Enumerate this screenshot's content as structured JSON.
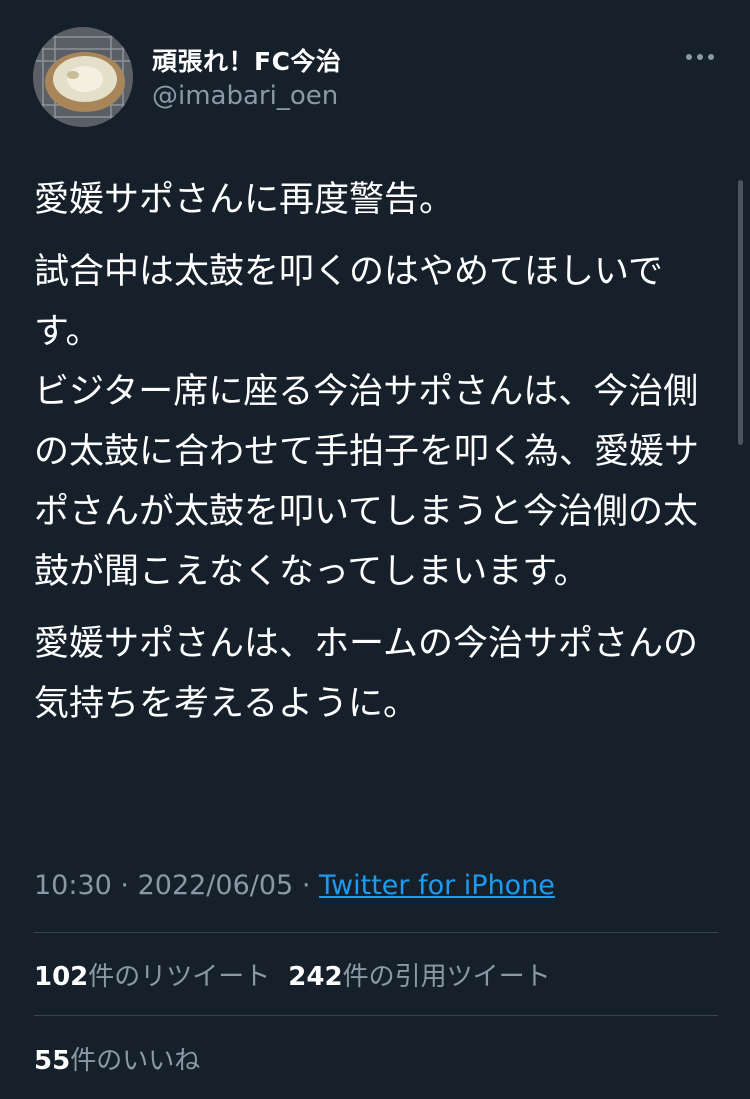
{
  "author": {
    "display_name": "頑張れ！FC今治",
    "handle": "@imabari_oen"
  },
  "tweet": {
    "paragraphs": [
      "愛媛サポさんに再度警告。",
      "試合中は太鼓を叩くのはやめてほしいです。\nビジター席に座る今治サポさんは、今治側の太鼓に合わせて手拍子を叩く為、愛媛サポさんが太鼓を叩いてしまうと今治側の太鼓が聞こえなくなってしまいます。",
      "愛媛サポさんは、ホームの今治サポさんの気持ちを考えるように。"
    ]
  },
  "meta": {
    "time": "10:30",
    "separator": "·",
    "date": "2022/06/05",
    "source": "Twitter for iPhone"
  },
  "stats": {
    "retweets_count": "102",
    "retweets_label": "件のリツイート",
    "quotes_count": "242",
    "quotes_label": "件の引用ツイート",
    "likes_count": "55",
    "likes_label": "件のいいね"
  },
  "colors": {
    "background": "#15202b",
    "text_primary": "#ffffff",
    "text_secondary": "#8b98a5",
    "link": "#1d9bf0",
    "divider": "#38444d"
  },
  "icons": {
    "more": "more-horizontal-icon"
  }
}
